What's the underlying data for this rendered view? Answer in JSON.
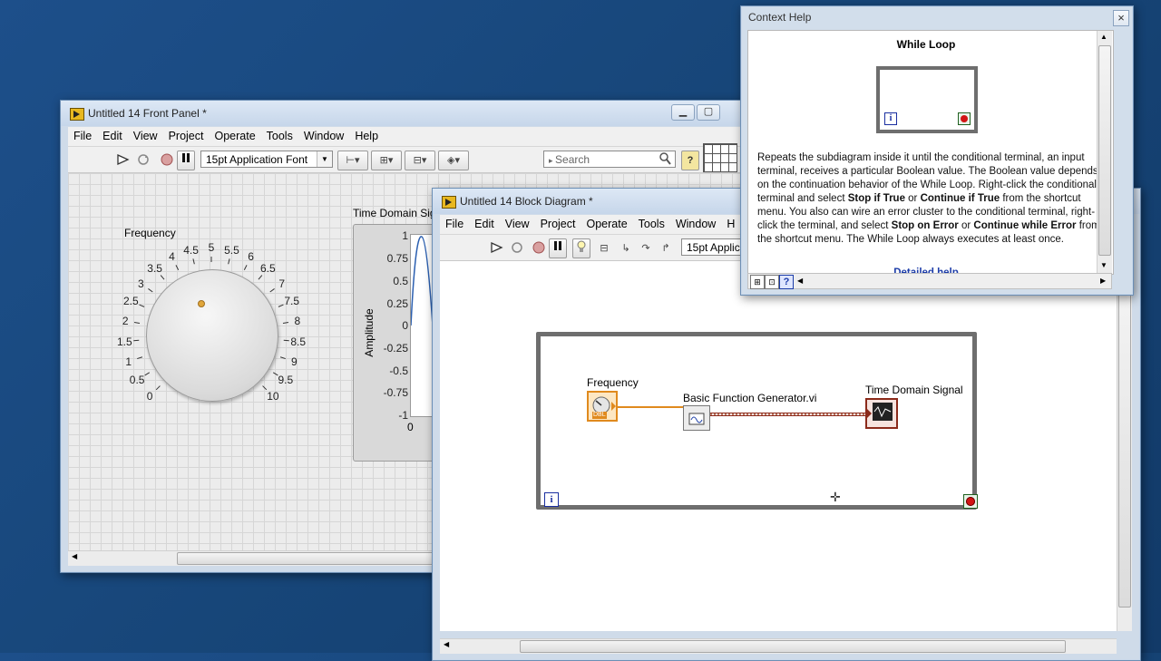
{
  "front_panel": {
    "title": "Untitled 14 Front Panel *",
    "menu": [
      "File",
      "Edit",
      "View",
      "Project",
      "Operate",
      "Tools",
      "Window",
      "Help"
    ],
    "font_combo": "15pt Application Font",
    "search_placeholder": "Search",
    "knob": {
      "label": "Frequency",
      "scale": [
        "0",
        "0.5",
        "1",
        "1.5",
        "2",
        "2.5",
        "3",
        "3.5",
        "4",
        "4.5",
        "5",
        "5.5",
        "6",
        "6.5",
        "7",
        "7.5",
        "8",
        "8.5",
        "9",
        "9.5",
        "10"
      ]
    },
    "graph": {
      "title": "Time Domain Sig",
      "ylabel": "Amplitude",
      "yticks": [
        "1",
        "0.75",
        "0.5",
        "0.25",
        "0",
        "-0.25",
        "-0.5",
        "-0.75",
        "-1"
      ],
      "xtick": "0"
    }
  },
  "block_diagram": {
    "title": "Untitled 14 Block Diagram *",
    "menu": [
      "File",
      "Edit",
      "View",
      "Project",
      "Operate",
      "Tools",
      "Window",
      "H"
    ],
    "font_combo": "15pt Applic",
    "frequency_label": "Frequency",
    "dbl_label": "DBL",
    "function_label": "Basic Function Generator.vi",
    "indicator_label": "Time Domain Signal",
    "iteration_terminal": "i"
  },
  "context_help": {
    "title": "Context Help",
    "heading": "While Loop",
    "iteration_terminal": "i",
    "body_parts": [
      {
        "t": "Repeats the subdiagram inside it until the conditional terminal, an input terminal, receives a particular Boolean value. The Boolean value depends on the continuation behavior of the While Loop. Right-click the conditional terminal and select ",
        "b": false
      },
      {
        "t": "Stop if True",
        "b": true
      },
      {
        "t": " or ",
        "b": false
      },
      {
        "t": "Continue if True",
        "b": true
      },
      {
        "t": " from the shortcut menu. You also can wire an error cluster to the conditional terminal, right-click the terminal, and select ",
        "b": false
      },
      {
        "t": "Stop on Error",
        "b": true
      },
      {
        "t": " or ",
        "b": false
      },
      {
        "t": "Continue while Error",
        "b": true
      },
      {
        "t": " from the shortcut menu. The While Loop always executes at least once.",
        "b": false
      }
    ],
    "link": "Detailed help",
    "close": "×"
  },
  "colors": {
    "desktop": "#174679",
    "loop_border": "#6e6e6e",
    "dbl_orange": "#e08a1e",
    "waveform_wire": "#8b2a1a",
    "stop_red": "#d21414",
    "iteration_blue": "#1a2fa0"
  }
}
